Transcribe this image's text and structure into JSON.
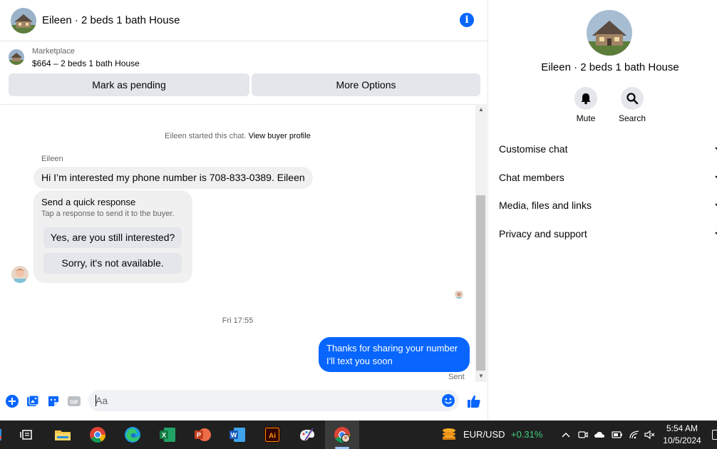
{
  "chat": {
    "title": "Eileen · 2 beds 1 bath House",
    "listing": {
      "source": "Marketplace",
      "detail": "$664 – 2 beds 1 bath House"
    },
    "actions": {
      "pending_label": "Mark as pending",
      "more_label": "More Options"
    },
    "system_message": "Eileen started this chat.",
    "view_profile_link": "View buyer profile",
    "sender_name": "Eileen",
    "incoming_message": "Hi I’m interested my phone number is 708-833-0389. Eileen",
    "quick_response": {
      "title": "Send a quick response",
      "subtitle": "Tap a response to send it to the buyer.",
      "options": [
        "Yes, are you still interested?",
        "Sorry, it's not available."
      ]
    },
    "timestamp": "Fri 17:55",
    "outgoing_message": "Thanks for sharing your number I'll text you soon",
    "sent_status": "Sent",
    "composer": {
      "placeholder": "Aa"
    }
  },
  "info": {
    "title": "Eileen · 2 beds 1 bath House",
    "mute_label": "Mute",
    "search_label": "Search",
    "sections": [
      "Customise chat",
      "Chat members",
      "Media, files and links",
      "Privacy and support"
    ]
  },
  "taskbar": {
    "ticker_name": "EUR/USD",
    "ticker_change": "+0.31%",
    "time": "5:54 AM",
    "date": "10/5/2024",
    "apps": [
      "task-view",
      "file-explorer",
      "chrome",
      "edge",
      "excel",
      "powerpoint",
      "word",
      "illustrator",
      "paint",
      "chrome-profile"
    ]
  },
  "colors": {
    "accent": "#0866ff",
    "bubble_gray": "#f0f0f0",
    "button_gray": "#e4e6eb",
    "ticker_green": "#3ed37a"
  }
}
